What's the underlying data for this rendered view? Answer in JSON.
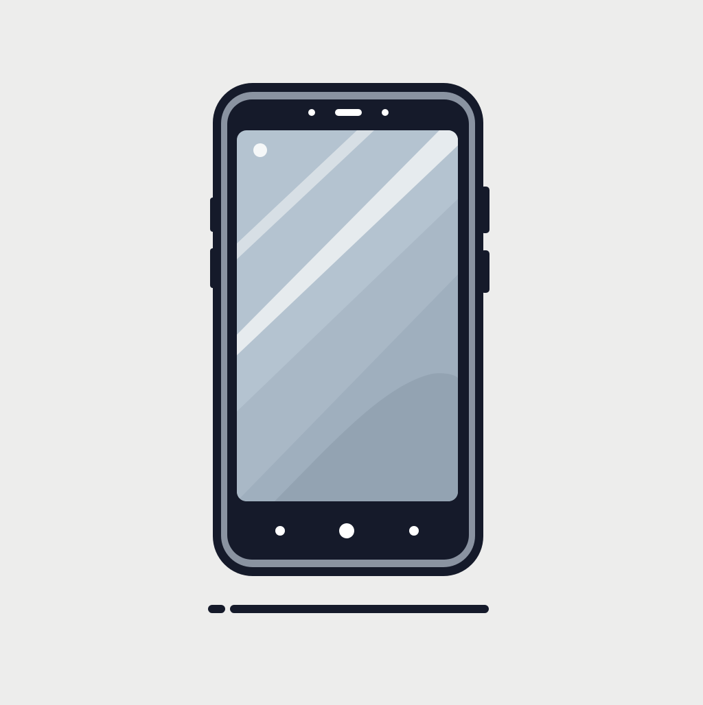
{
  "scene": {
    "subject": "smartphone-icon",
    "colors": {
      "background": "#ededec",
      "frame": "#151a2a",
      "bezel_ring": "#8a93a1",
      "screen_light": "#b4c3d0",
      "screen_mid": "#a5b5c4",
      "screen_dark": "#92a2b1",
      "highlight": "#e6ebee",
      "dots": "#ffffff"
    }
  }
}
